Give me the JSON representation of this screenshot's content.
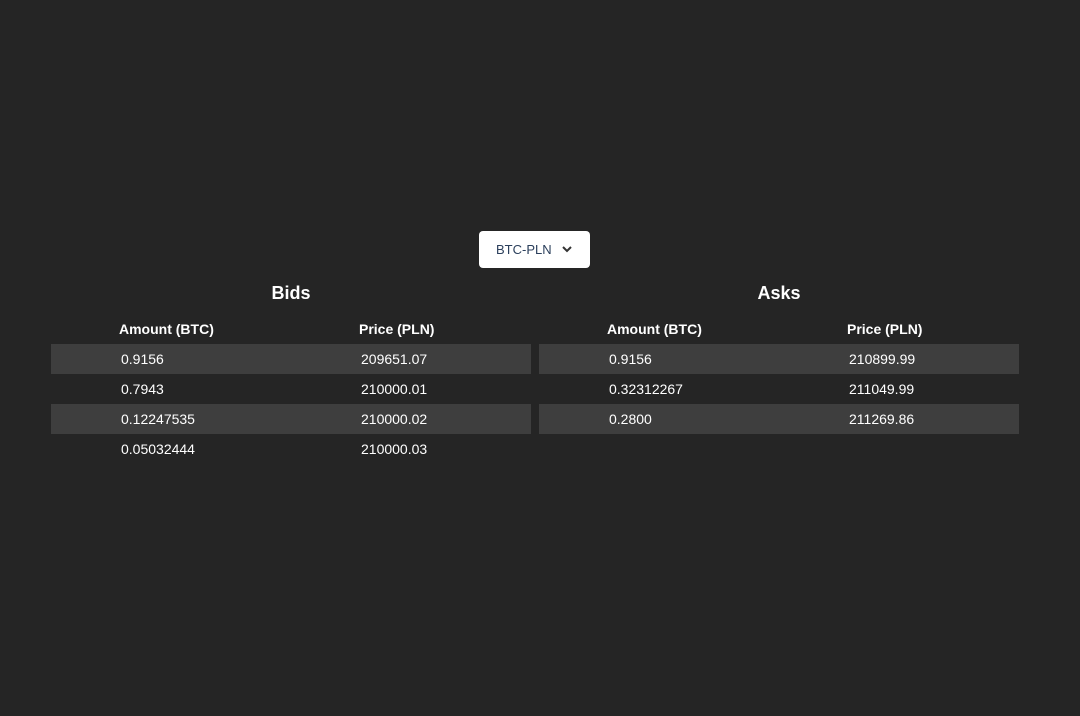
{
  "pair_select": {
    "value": "BTC-PLN"
  },
  "bids": {
    "title": "Bids",
    "headers": [
      "Amount (BTC)",
      "Price (PLN)"
    ],
    "rows": [
      [
        "0.9156",
        "209651.07"
      ],
      [
        "0.7943",
        "210000.01"
      ],
      [
        "0.12247535",
        "210000.02"
      ],
      [
        "0.05032444",
        "210000.03"
      ]
    ]
  },
  "asks": {
    "title": "Asks",
    "headers": [
      "Amount (BTC)",
      "Price (PLN)"
    ],
    "rows": [
      [
        "0.9156",
        "210899.99"
      ],
      [
        "0.32312267",
        "211049.99"
      ],
      [
        "0.2800",
        "211269.86"
      ]
    ]
  },
  "colors": {
    "background": "#252525",
    "row_alt": "#3e3e3e"
  }
}
